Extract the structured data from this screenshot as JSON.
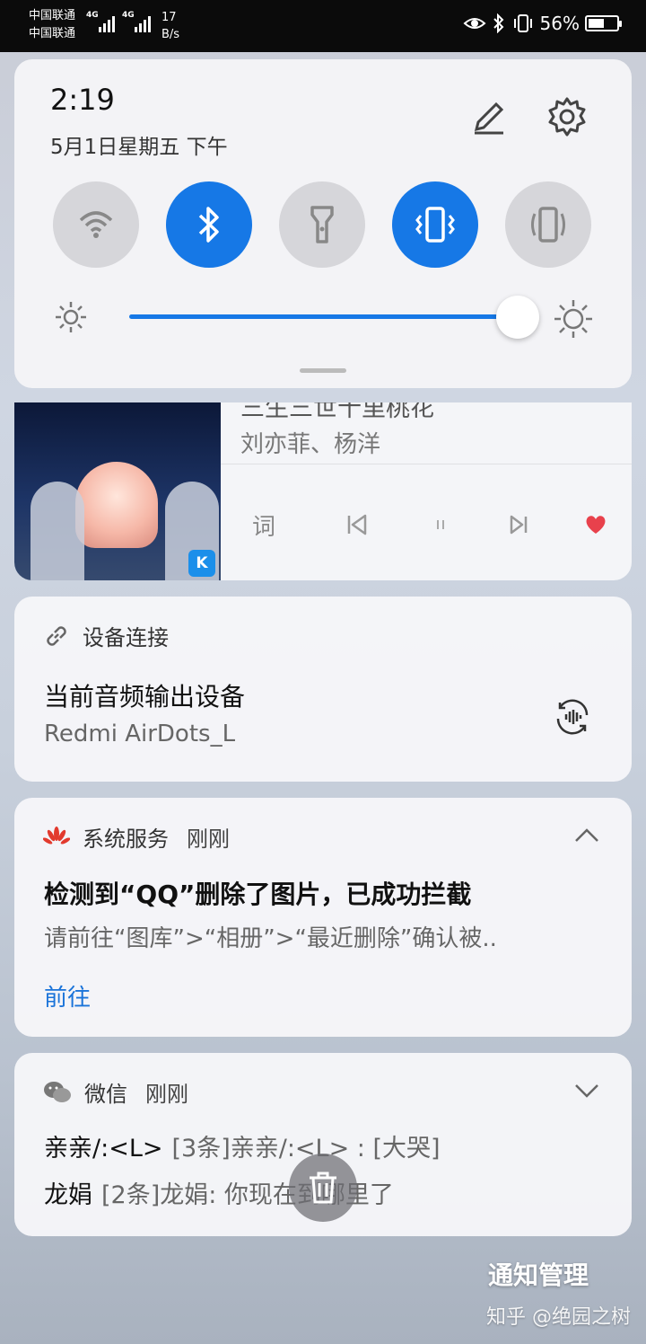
{
  "status_bar": {
    "carrier1": "中国联通",
    "carrier2": "中国联通",
    "net1": "4G",
    "net2": "4G",
    "speed_value": "17",
    "speed_unit": "B/s",
    "battery": "56%"
  },
  "quick_settings": {
    "time": "2:19",
    "date": "5月1日星期五 下午",
    "toggles": [
      {
        "icon": "wifi-icon",
        "on": false
      },
      {
        "icon": "bluetooth-icon",
        "on": true
      },
      {
        "icon": "flashlight-icon",
        "on": false
      },
      {
        "icon": "vibrate-icon",
        "on": true
      },
      {
        "icon": "auto-rotate-icon",
        "on": false
      }
    ],
    "brightness_level": 0.93,
    "accent_color": "#1678e6"
  },
  "music": {
    "song": "三生三世十里桃花",
    "artist": "刘亦菲、杨洋",
    "lyrics_label": "词",
    "app_badge": "K",
    "liked": true
  },
  "device_card": {
    "header": "设备连接",
    "title": "当前音频输出设备",
    "device": "Redmi AirDots_L"
  },
  "system_card": {
    "app": "系统服务",
    "time": "刚刚",
    "title": "检测到“QQ”删除了图片，已成功拦截",
    "body": "请前往“图库”>“相册”>“最近删除”确认被..",
    "action": "前往"
  },
  "wechat_card": {
    "app": "微信",
    "time": "刚刚",
    "messages": [
      {
        "name": "亲亲/:<L>",
        "text": "[3条]亲亲/:<L> : [大哭]"
      },
      {
        "name": "龙娟",
        "text": "[2条]龙娟: 你现在到哪里了"
      }
    ]
  },
  "footer": {
    "manage": "通知管理",
    "watermark": "知乎 @绝园之树"
  }
}
